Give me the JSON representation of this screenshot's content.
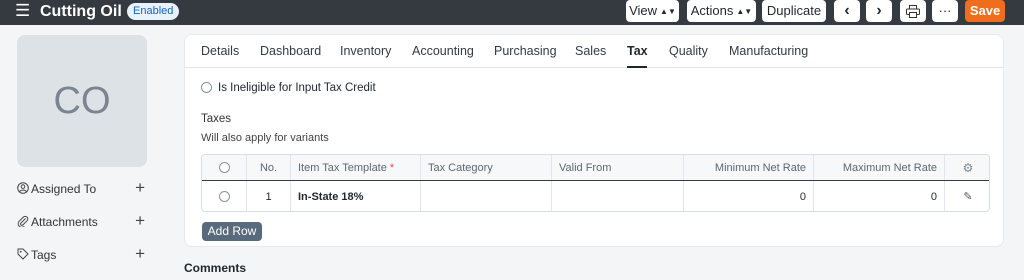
{
  "header": {
    "title": "Cutting Oil",
    "status": "Enabled",
    "buttons": {
      "view": "View",
      "actions": "Actions",
      "duplicate": "Duplicate",
      "save": "Save"
    }
  },
  "sidebar": {
    "avatar_initials": "CO",
    "items": [
      {
        "label": "Assigned To",
        "icon": "user-circle-icon"
      },
      {
        "label": "Attachments",
        "icon": "paperclip-icon"
      },
      {
        "label": "Tags",
        "icon": "tag-icon"
      }
    ]
  },
  "tabs": [
    {
      "label": "Details"
    },
    {
      "label": "Dashboard"
    },
    {
      "label": "Inventory"
    },
    {
      "label": "Accounting"
    },
    {
      "label": "Purchasing"
    },
    {
      "label": "Sales"
    },
    {
      "label": "Tax",
      "active": true
    },
    {
      "label": "Quality"
    },
    {
      "label": "Manufacturing"
    }
  ],
  "tax_form": {
    "ineligible_label": "Is Ineligible for Input Tax Credit",
    "section_label": "Taxes",
    "section_description": "Will also apply for variants",
    "table": {
      "columns": [
        "No.",
        "Item Tax Template",
        "Tax Category",
        "Valid From",
        "Minimum Net Rate",
        "Maximum Net Rate"
      ],
      "rows": [
        {
          "no": "1",
          "item_tax_template": "In-State 18%",
          "tax_category": "",
          "valid_from": "",
          "minimum_net_rate": "0",
          "maximum_net_rate": "0"
        }
      ]
    },
    "add_row_label": "Add Row"
  },
  "comments_label": "Comments"
}
